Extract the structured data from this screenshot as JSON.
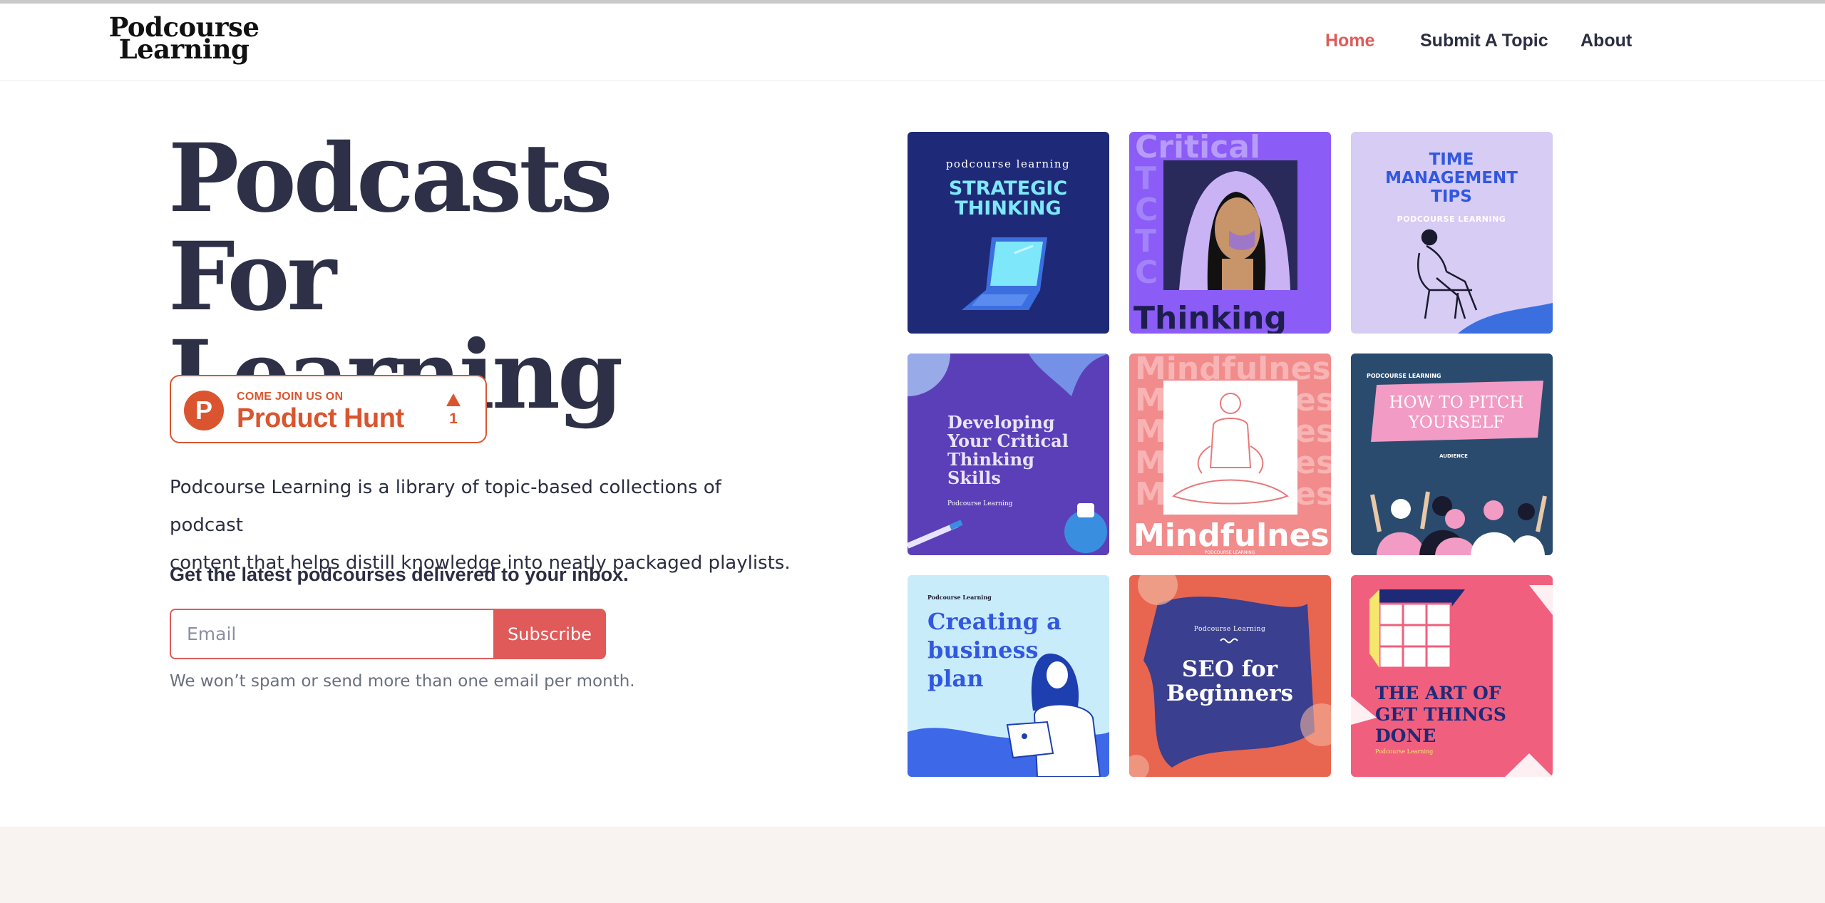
{
  "header": {
    "logo_line1": "Podcourse",
    "logo_line2": "Learning",
    "nav": [
      {
        "label": "Home",
        "active": true
      },
      {
        "label": "Submit A Topic",
        "active": false
      },
      {
        "label": "About",
        "active": false
      }
    ]
  },
  "hero": {
    "title_line1": "Podcasts For",
    "title_line2": "Learning",
    "product_hunt": {
      "icon_letter": "P",
      "small_label": "COME JOIN US ON",
      "big_label": "Product Hunt",
      "upvotes": "1"
    },
    "description_line1": "Podcourse Learning is a library of topic-based collections of podcast",
    "description_line2": "content that helps distill knowledge into neatly packaged playlists.",
    "cta": "Get the latest podcourses delivered to your inbox.",
    "email_placeholder": "Email",
    "subscribe_label": "Subscribe",
    "note": "We won’t spam or send more than one email per month."
  },
  "covers": [
    {
      "id": "strategic-thinking",
      "brand": "podcourse learning",
      "title_lines": [
        "STRATEGIC",
        "THINKING"
      ],
      "bg": "#1e2a78"
    },
    {
      "id": "critical-thinking",
      "bg_word": "Critical",
      "title": "Thinking",
      "bg": "#8b5cf6"
    },
    {
      "id": "time-management",
      "title_lines": [
        "TIME",
        "MANAGEMENT",
        "TIPS"
      ],
      "brand": "PODCOURSE LEARNING",
      "bg": "#d7ccf4"
    },
    {
      "id": "developing-critical",
      "title_lines": [
        "Developing",
        "Your Critical",
        "Thinking",
        "Skills"
      ],
      "brand": "Podcourse Learning",
      "bg": "#5b3fb8"
    },
    {
      "id": "mindfulness",
      "bg_word": "Mindfulness",
      "title": "Mindfulness",
      "brand": "PODCOURSE LEARNING",
      "bg": "#f28b8b"
    },
    {
      "id": "pitch-yourself",
      "brand": "PODCOURSE LEARNING",
      "title_lines": [
        "HOW TO PITCH",
        "YOURSELF"
      ],
      "small": "AUDIENCE",
      "bg": "#2a4b6e"
    },
    {
      "id": "business-plan",
      "brand": "Podcourse Learning",
      "title_lines": [
        "Creating a",
        "business",
        "plan"
      ],
      "bg": "#c9ecfb"
    },
    {
      "id": "seo-beginners",
      "brand": "Podcourse Learning",
      "title_lines": [
        "SEO for",
        "Beginners"
      ],
      "bg": "#e8664f"
    },
    {
      "id": "get-things-done",
      "title_lines": [
        "THE ART OF",
        "GET THINGS",
        "DONE"
      ],
      "brand": "Podcourse Learning",
      "bg": "#f0607e"
    }
  ]
}
